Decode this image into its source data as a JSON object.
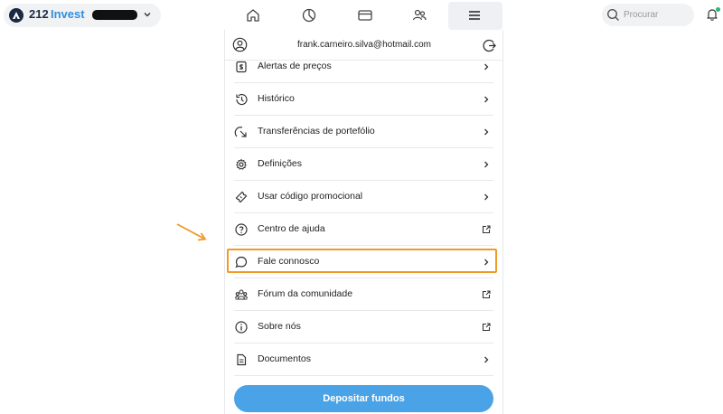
{
  "brand": {
    "number": "212",
    "name": "Invest",
    "logo_icon": "a-logo-icon"
  },
  "account": {
    "masked": true,
    "chevron_icon": "chevron-down-icon"
  },
  "nav": [
    {
      "name": "home",
      "icon": "home-icon"
    },
    {
      "name": "portfolio",
      "icon": "pie-chart-icon"
    },
    {
      "name": "wallet",
      "icon": "card-icon"
    },
    {
      "name": "social",
      "icon": "people-icon"
    },
    {
      "name": "menu",
      "icon": "hamburger-icon",
      "active": true
    }
  ],
  "search": {
    "placeholder": "Procurar",
    "icon": "search-icon"
  },
  "notifications": {
    "icon": "bell-icon",
    "dot_color": "#2bb673"
  },
  "menu_panel": {
    "email": "frank.carneiro.silva@hotmail.com",
    "items": [
      {
        "label": "Alertas de preços",
        "icon": "price-alert-icon",
        "trail": "chevron"
      },
      {
        "label": "Histórico",
        "icon": "history-icon",
        "trail": "chevron"
      },
      {
        "label": "Transferências de portefólio",
        "icon": "transfer-icon",
        "trail": "chevron"
      },
      {
        "label": "Definições",
        "icon": "gear-icon",
        "trail": "chevron"
      },
      {
        "label": "Usar código promocional",
        "icon": "ticket-icon",
        "trail": "chevron"
      },
      {
        "label": "Centro de ajuda",
        "icon": "help-icon",
        "trail": "external"
      },
      {
        "label": "Fale connosco",
        "icon": "chat-icon",
        "trail": "chevron",
        "highlighted": true
      },
      {
        "label": "Fórum da comunidade",
        "icon": "community-icon",
        "trail": "external"
      },
      {
        "label": "Sobre nós",
        "icon": "info-icon",
        "trail": "external"
      },
      {
        "label": "Documentos",
        "icon": "document-icon",
        "trail": "chevron"
      }
    ],
    "deposit_label": "Depositar fundos"
  },
  "colors": {
    "accent": "#4aa3e6",
    "brand_dark": "#1b2a44",
    "brand_blue": "#2f8fe0",
    "highlight": "#f09a28"
  }
}
